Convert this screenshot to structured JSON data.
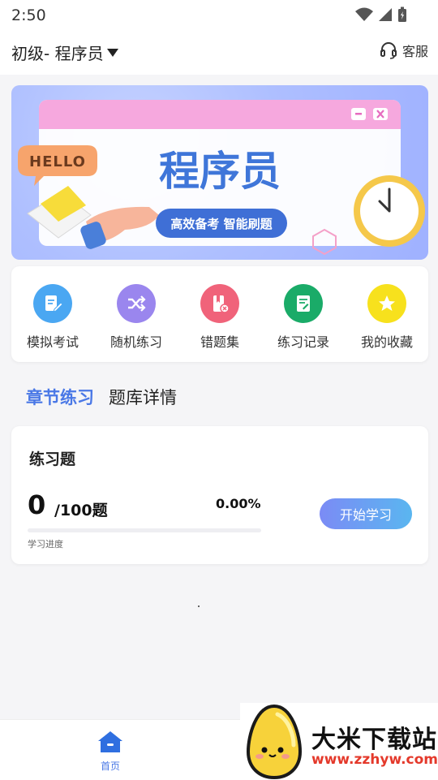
{
  "status": {
    "time": "2:50"
  },
  "header": {
    "level": "初级- 程序员",
    "service": "客服"
  },
  "banner": {
    "hello": "HELLO",
    "title": "程序员",
    "slogan": "高效备考 智能刷题"
  },
  "quick_actions": [
    {
      "label": "模拟考试",
      "icon": "exam-edit-icon",
      "color": "#4aa7f2"
    },
    {
      "label": "随机练习",
      "icon": "shuffle-icon",
      "color": "#9a86ee"
    },
    {
      "label": "错题集",
      "icon": "wrong-book-icon",
      "color": "#f0637a"
    },
    {
      "label": "练习记录",
      "icon": "record-icon",
      "color": "#1aab68"
    },
    {
      "label": "我的收藏",
      "icon": "star-icon",
      "color": "#f7e11d"
    }
  ],
  "tabs": {
    "chapter": "章节练习",
    "bank": "题库详情"
  },
  "practice": {
    "title": "练习题",
    "count": "0",
    "total": "/100题",
    "percent": "0.00%",
    "progress": 0,
    "progress_label": "学习进度",
    "start_button": "开始学习"
  },
  "nav": {
    "home": "首页"
  },
  "watermark": {
    "name": "大米下载站",
    "url": "www.zzhyw.com"
  }
}
